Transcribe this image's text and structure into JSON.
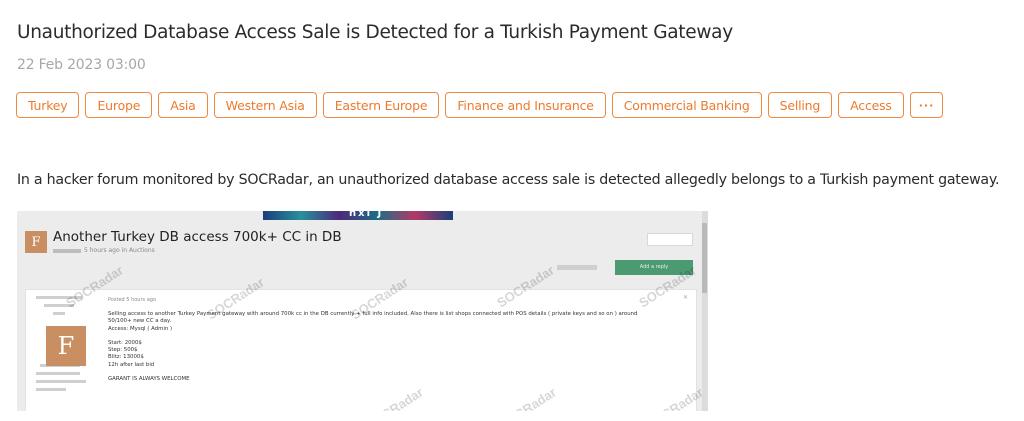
{
  "article": {
    "title": "Unauthorized Database Access Sale is Detected for a Turkish Payment Gateway",
    "date": "22 Feb 2023 03:00",
    "tags": [
      "Turkey",
      "Europe",
      "Asia",
      "Western Asia",
      "Eastern Europe",
      "Finance and Insurance",
      "Commercial Banking",
      "Selling",
      "Access"
    ],
    "more_tags_label": "···",
    "description": "In a hacker forum monitored by SOCRadar, an unauthorized database access sale is detected allegedly belongs to a Turkish payment gateway."
  },
  "screenshot": {
    "banner_text": "nxl J",
    "avatar_letter": "F",
    "thread_title": "Another Turkey DB access 700k+ CC in DB",
    "thread_meta": "5 hours ago in Auctions",
    "reply_button": "Add a reply",
    "posted": "Posted 5 hours ago",
    "post_lines": [
      "Selling access to another Turkey Payment gateway with around 700k cc in the DB currently + full info included. Also there is list shops connected with POS details ( private keys and so on ) around",
      "50/100+ new CC a day.",
      "Access: Mysql ( Admin )",
      "",
      "Start: 2000$",
      "Step: 500$",
      "Blitz: 13000$",
      "12h after last bid",
      "",
      "GARANT IS ALWAYS WELCOME"
    ],
    "watermark": "SOCRadar"
  }
}
